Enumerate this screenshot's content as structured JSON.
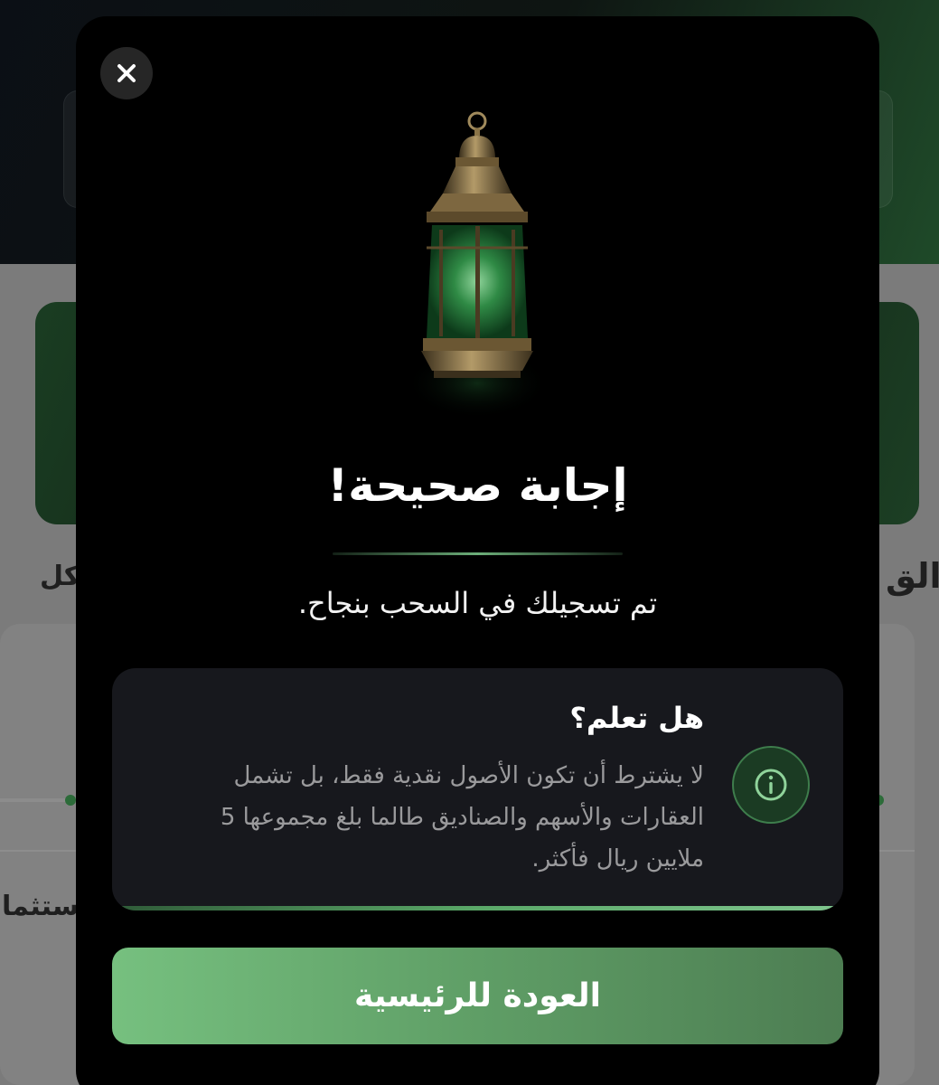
{
  "modal": {
    "close_icon": "close-icon",
    "illustration": "ramadan-lantern",
    "title": "إجابة صحيحة!",
    "subtitle": "تم تسجيلك في السحب بنجاح.",
    "fact": {
      "title": "هل تعلم؟",
      "body": "لا يشترط أن تكون الأصول نقدية فقط، بل تشمل العقارات والأسهم والصناديق طالما بلغ مجموعها 5 ملايين ريال فأكثر.",
      "icon": "info-icon"
    },
    "home_button_label": "العودة للرئيسية"
  },
  "background": {
    "partial_heading_right": "الق",
    "partial_heading_left": "كل",
    "partial_row_label": "ستثما"
  },
  "colors": {
    "modal_bg": "#000000",
    "card_bg": "#17181d",
    "accent_green": "#5aa868",
    "button_gradient_start": "#76c07f",
    "button_gradient_end": "#4d7d52"
  }
}
